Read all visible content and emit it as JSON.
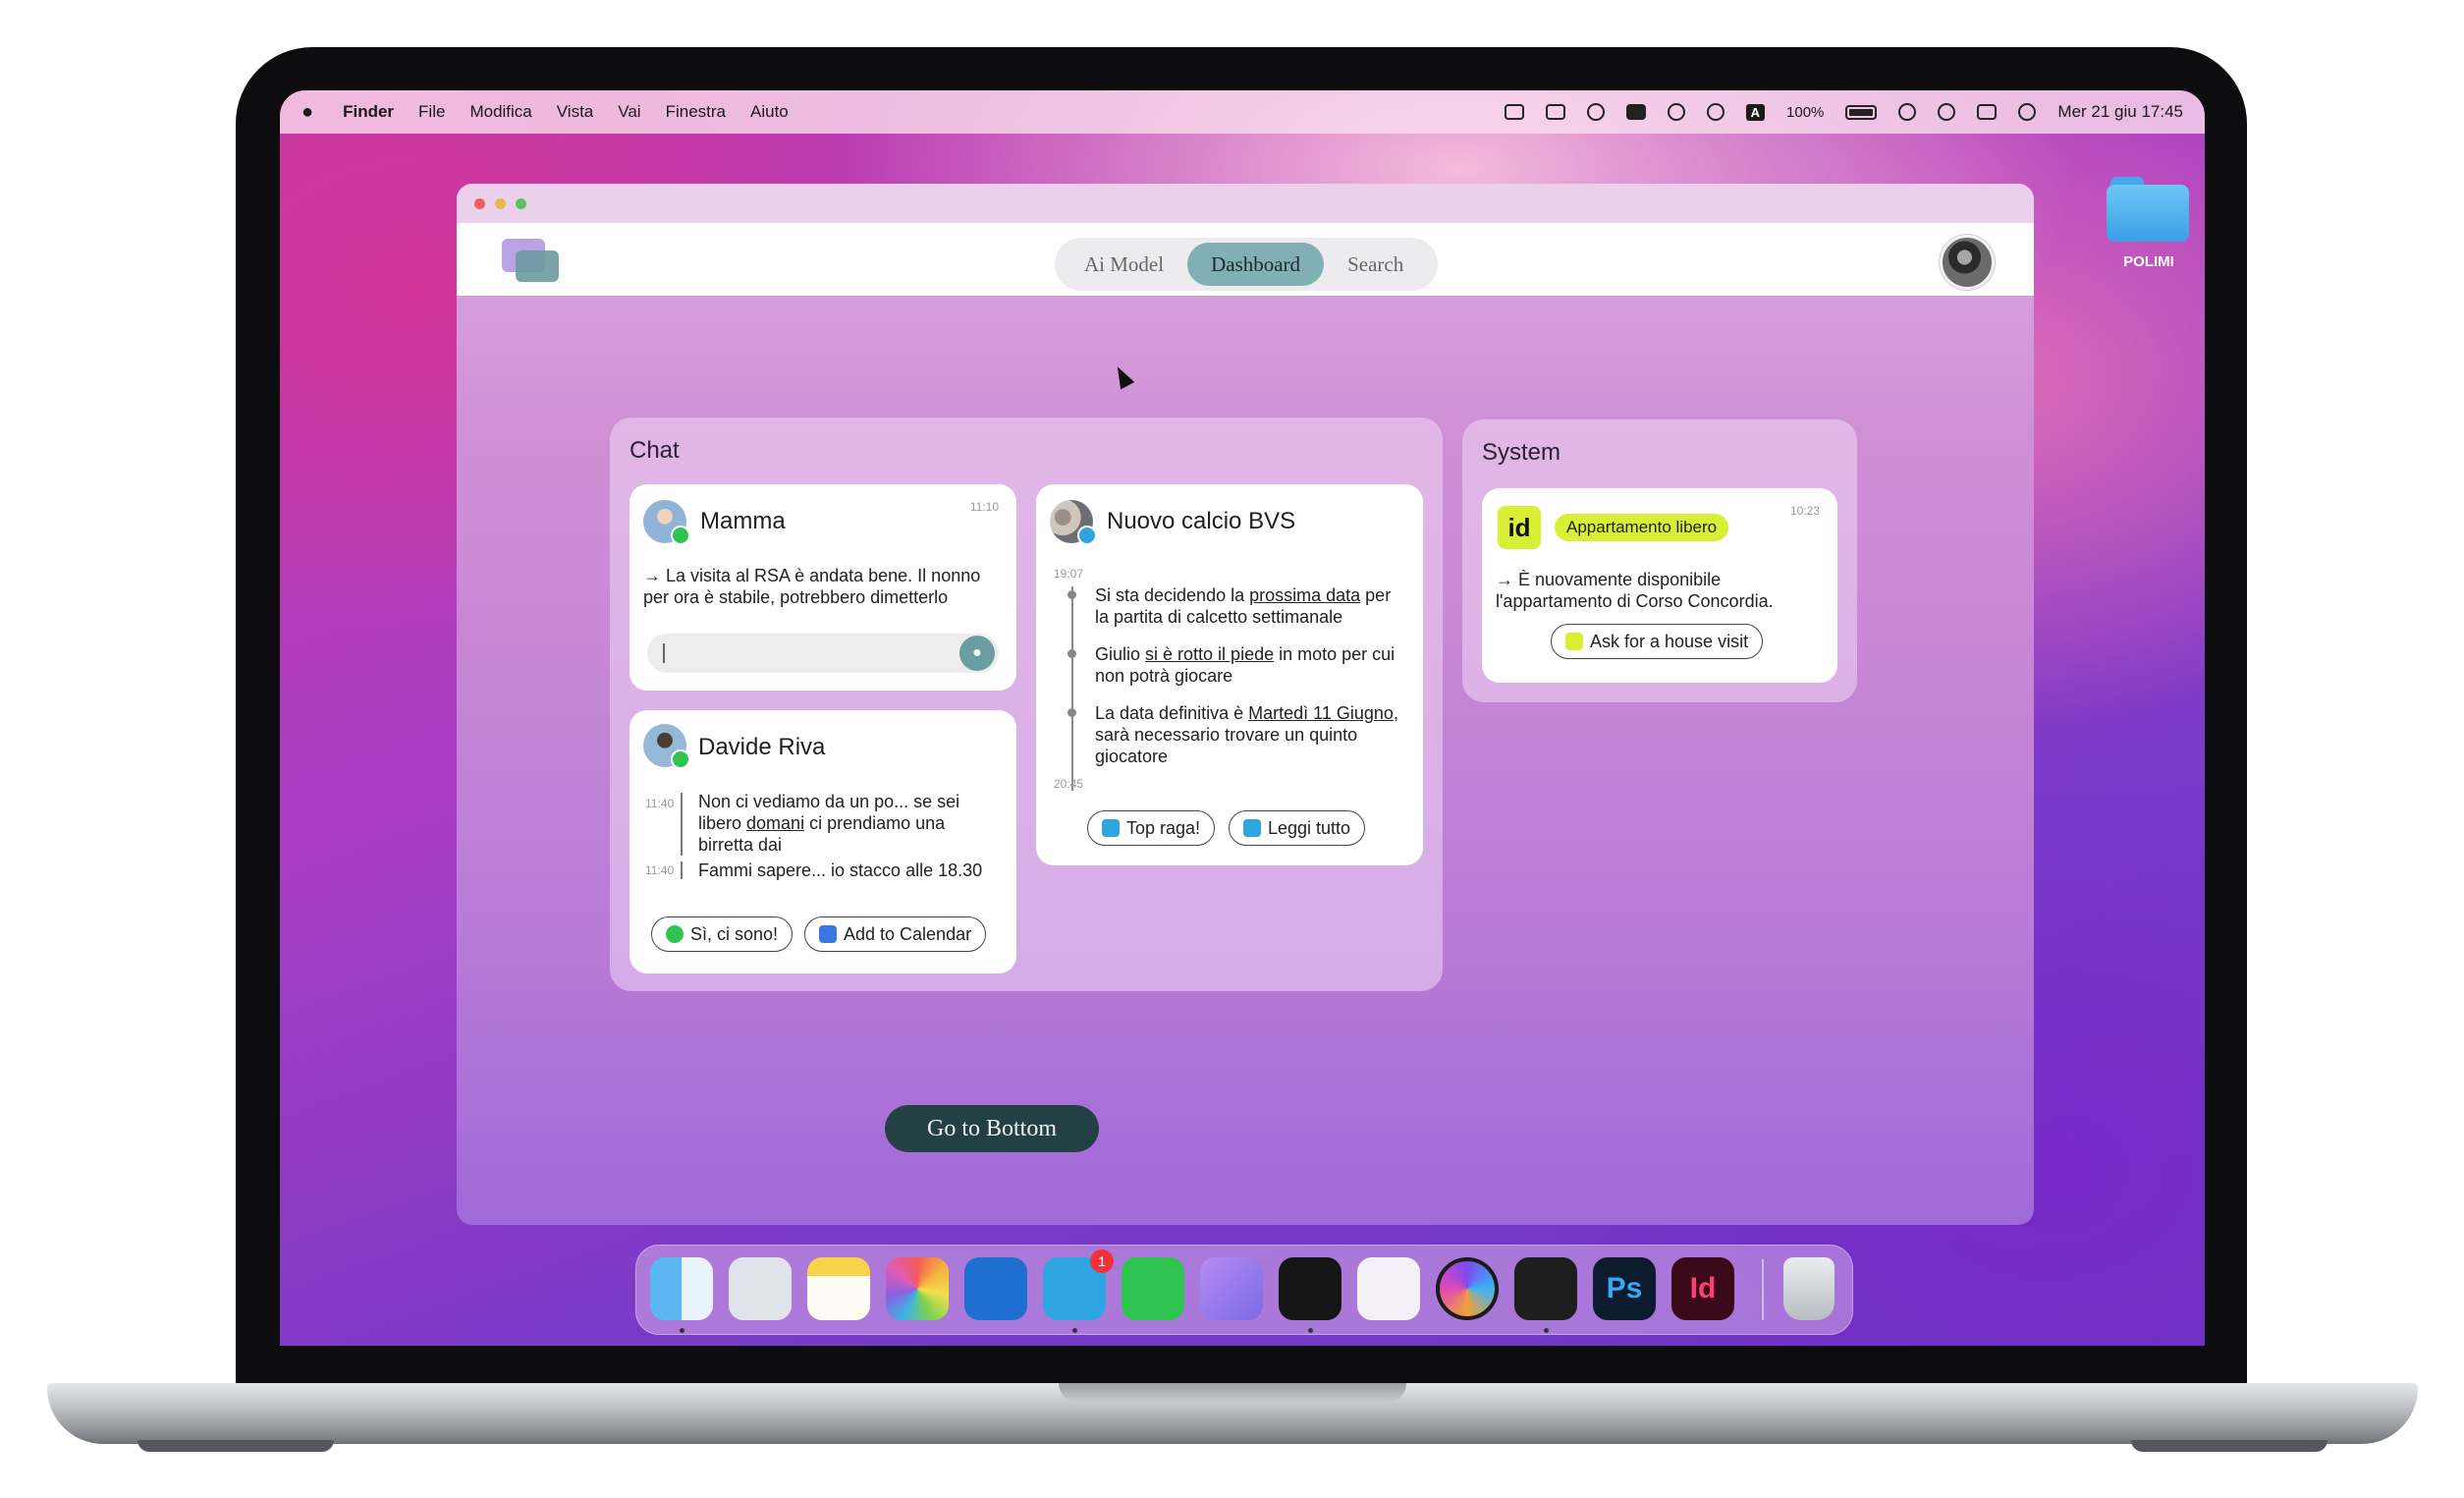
{
  "menubar": {
    "app_name": "Finder",
    "items": [
      "File",
      "Modifica",
      "Vista",
      "Vai",
      "Finestra",
      "Aiuto"
    ],
    "battery": "100%",
    "input_key": "A",
    "clock": "Mer 21 giu  17:45"
  },
  "nav": {
    "tabs": [
      {
        "label": "Ai Model",
        "active": false
      },
      {
        "label": "Dashboard",
        "active": true
      },
      {
        "label": "Search",
        "active": false
      }
    ]
  },
  "chat": {
    "title": "Chat",
    "mamma": {
      "name": "Mamma",
      "time": "11:10",
      "message": "→ La visita al RSA è andata bene. Il nonno per ora è stabile, potrebbero dimetterlo",
      "input_value": ""
    },
    "bvs": {
      "name": "Nuovo calcio BVS",
      "time_start": "19:07",
      "time_end": "20:45",
      "items": [
        {
          "pre": "Si sta decidendo la ",
          "link": "prossima data",
          "post": " per la partita di calcetto settimanale"
        },
        {
          "pre": "Giulio ",
          "link": "si è rotto il piede",
          "post": " in moto per cui non potrà giocare"
        },
        {
          "pre": "La data definitiva è ",
          "link": "Martedì 11 Giugno",
          "post": ", sarà necessario trovare un quinto giocatore"
        }
      ],
      "buttons": [
        "Top raga!",
        "Leggi tutto"
      ]
    },
    "davide": {
      "name": "Davide Riva",
      "messages": [
        {
          "time": "11:40",
          "pre": "Non ci vediamo da un po... se sei libero ",
          "link": "domani",
          "post": " ci prendiamo una birretta dai"
        },
        {
          "time": "11:40",
          "pre": "Fammi sapere... io stacco alle 18.30",
          "link": "",
          "post": ""
        }
      ],
      "buttons": [
        "Sì, ci sono!",
        "Add to Calendar"
      ]
    }
  },
  "system": {
    "title": "System",
    "card": {
      "logo": "id",
      "tag": "Appartamento libero",
      "time": "10:23",
      "message": "→ È nuovamente disponibile l'appartamento di Corso Concordia.",
      "button": "Ask for a house visit"
    }
  },
  "go_bottom": "Go to Bottom",
  "desktop": {
    "folder_label": "POLIMI"
  },
  "dock": {
    "telegram_badge": "1",
    "photoshop_label": "Ps",
    "indesign_label": "Id"
  },
  "colors": {
    "accent_teal": "#80afb5",
    "dark_teal": "#234045",
    "lime": "#d8ef35"
  }
}
